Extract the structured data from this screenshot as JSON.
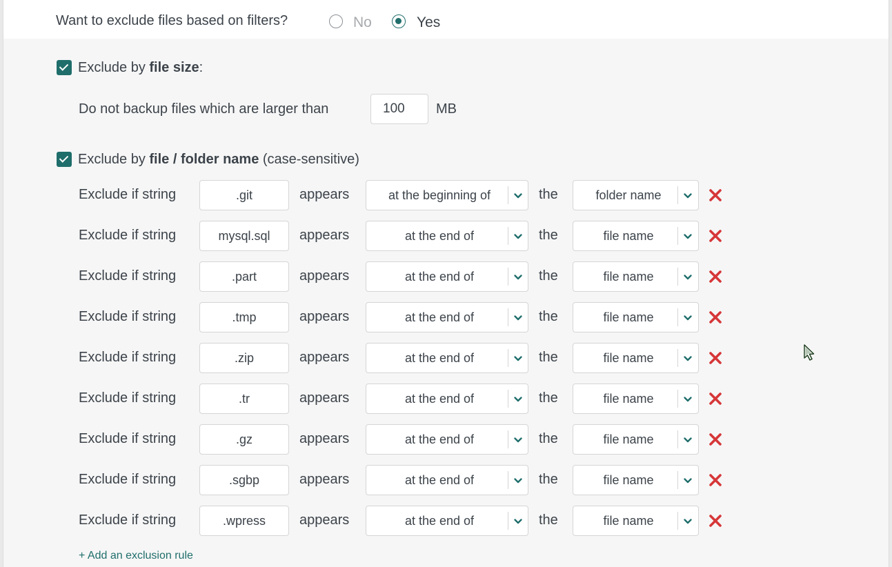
{
  "filters": {
    "question": "Want to exclude files based on filters?",
    "no_label": "No",
    "yes_label": "Yes",
    "selected": "Yes"
  },
  "file_size": {
    "label_pre": "Exclude by ",
    "label_bold": "file size",
    "label_post": ":",
    "checked": true,
    "description": "Do not backup files which are larger than",
    "value": "100",
    "unit": "MB"
  },
  "file_name": {
    "label_pre": "Exclude by ",
    "label_bold": "file / folder name",
    "label_post": " (case-sensitive)",
    "checked": true,
    "rule_prefix": "Exclude if string",
    "appears_label": "appears",
    "the_label": "the",
    "rules": [
      {
        "string": ".git",
        "position": "at the beginning of",
        "target": "folder name"
      },
      {
        "string": "mysql.sql",
        "position": "at the end of",
        "target": "file name"
      },
      {
        "string": ".part",
        "position": "at the end of",
        "target": "file name"
      },
      {
        "string": ".tmp",
        "position": "at the end of",
        "target": "file name"
      },
      {
        "string": ".zip",
        "position": "at the end of",
        "target": "file name"
      },
      {
        "string": ".tr",
        "position": "at the end of",
        "target": "file name"
      },
      {
        "string": ".gz",
        "position": "at the end of",
        "target": "file name"
      },
      {
        "string": ".sgbp",
        "position": "at the end of",
        "target": "file name"
      },
      {
        "string": ".wpress",
        "position": "at the end of",
        "target": "file name"
      }
    ],
    "add_rule_label": "+ Add an exclusion rule"
  },
  "icons": {
    "delete": "close-x-icon",
    "dropdown": "chevron-down-icon",
    "cursor": "mouse-pointer-icon"
  },
  "colors": {
    "accent": "#1f6e6b",
    "delete": "#d63638",
    "text": "#3c434a"
  }
}
